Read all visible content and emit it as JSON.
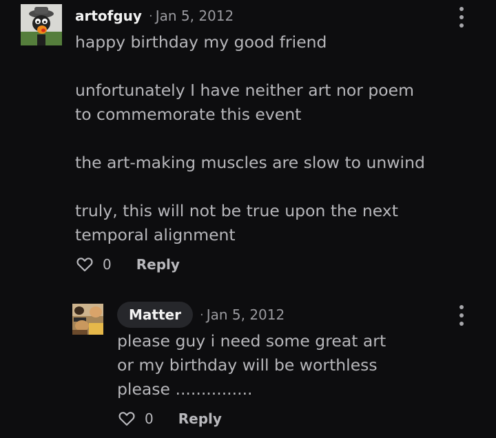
{
  "comments": [
    {
      "author": "artofguy",
      "separator": "·",
      "date": "Jan 5, 2012",
      "body": [
        "happy birthday my good friend",
        "",
        "unfortunately I have neither art nor poem",
        "to commemorate this event",
        "",
        "the art-making muscles are slow to unwind",
        "",
        "truly, this will not be true upon the next",
        "temporal alignment"
      ],
      "likes": "0",
      "reply_label": "Reply"
    },
    {
      "author": "Matter",
      "separator": "·",
      "date": "Jan 5, 2012",
      "body": [
        "please guy i need some great art",
        "or my birthday will be worthless",
        "please ..............."
      ],
      "likes": "0",
      "reply_label": "Reply"
    }
  ],
  "icons": {
    "like": "heart-outline-icon",
    "menu": "more-vertical-icon"
  }
}
